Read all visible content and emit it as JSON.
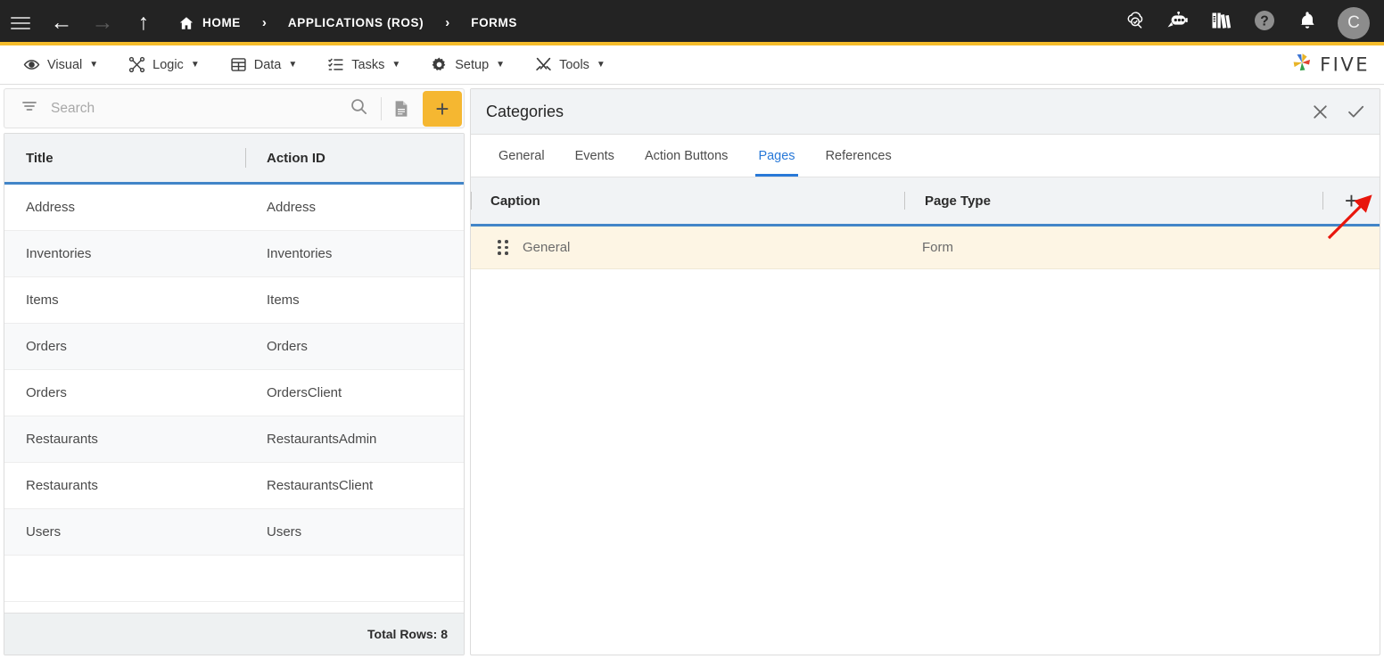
{
  "topbar": {
    "menu_icon": "hamburger-icon",
    "back_icon": "arrow-left-icon",
    "forward_icon": "arrow-right-icon",
    "up_icon": "arrow-up-icon",
    "breadcrumb": [
      {
        "label": "HOME",
        "icon": "home-icon"
      },
      {
        "label": "APPLICATIONS (ROS)",
        "icon": ""
      },
      {
        "label": "FORMS",
        "icon": ""
      }
    ],
    "separator": "›",
    "right_icons": [
      "cloud-search-icon",
      "robot-chat-icon",
      "library-books-icon",
      "help-icon",
      "notification-bell-icon"
    ],
    "avatar_initial": "C"
  },
  "menubar": {
    "items": [
      {
        "label": "Visual",
        "icon": "eye-icon"
      },
      {
        "label": "Logic",
        "icon": "logic-network-icon"
      },
      {
        "label": "Data",
        "icon": "table-grid-icon"
      },
      {
        "label": "Tasks",
        "icon": "task-list-icon"
      },
      {
        "label": "Setup",
        "icon": "gear-icon"
      },
      {
        "label": "Tools",
        "icon": "tools-icon"
      }
    ],
    "caret": "▼",
    "logo_text": "FIVE"
  },
  "left_panel": {
    "search": {
      "placeholder": "Search",
      "value": "",
      "filter_icon": "filter-icon",
      "search_icon": "search-icon",
      "doc_icon": "document-icon",
      "add_label": "+"
    },
    "grid": {
      "columns": [
        "Title",
        "Action ID"
      ],
      "rows": [
        {
          "title": "Address",
          "action_id": "Address"
        },
        {
          "title": "Inventories",
          "action_id": "Inventories"
        },
        {
          "title": "Items",
          "action_id": "Items"
        },
        {
          "title": "Orders",
          "action_id": "Orders"
        },
        {
          "title": "Orders",
          "action_id": "OrdersClient"
        },
        {
          "title": "Restaurants",
          "action_id": "RestaurantsAdmin"
        },
        {
          "title": "Restaurants",
          "action_id": "RestaurantsClient"
        },
        {
          "title": "Users",
          "action_id": "Users"
        }
      ],
      "footer": "Total Rows: 8"
    }
  },
  "right_panel": {
    "title": "Categories",
    "close_icon": "close-icon",
    "confirm_icon": "check-icon",
    "tabs": [
      {
        "label": "General",
        "active": false
      },
      {
        "label": "Events",
        "active": false
      },
      {
        "label": "Action Buttons",
        "active": false
      },
      {
        "label": "Pages",
        "active": true
      },
      {
        "label": "References",
        "active": false
      }
    ],
    "grid": {
      "columns": [
        "Caption",
        "Page Type"
      ],
      "add_label": "+",
      "rows": [
        {
          "caption": "General",
          "page_type": "Form",
          "handle": "drag-handle-icon"
        }
      ]
    }
  },
  "annotation": {
    "arrow_color": "#e8160c",
    "target": "add-page-button"
  },
  "colors": {
    "topbar_bg": "#232323",
    "accent_gold": "#f5bc2b",
    "grid_underline_blue": "#4285c8",
    "active_tab_blue": "#2979d8",
    "highlight_row": "#fdf5e4",
    "add_button": "#f5b731"
  }
}
